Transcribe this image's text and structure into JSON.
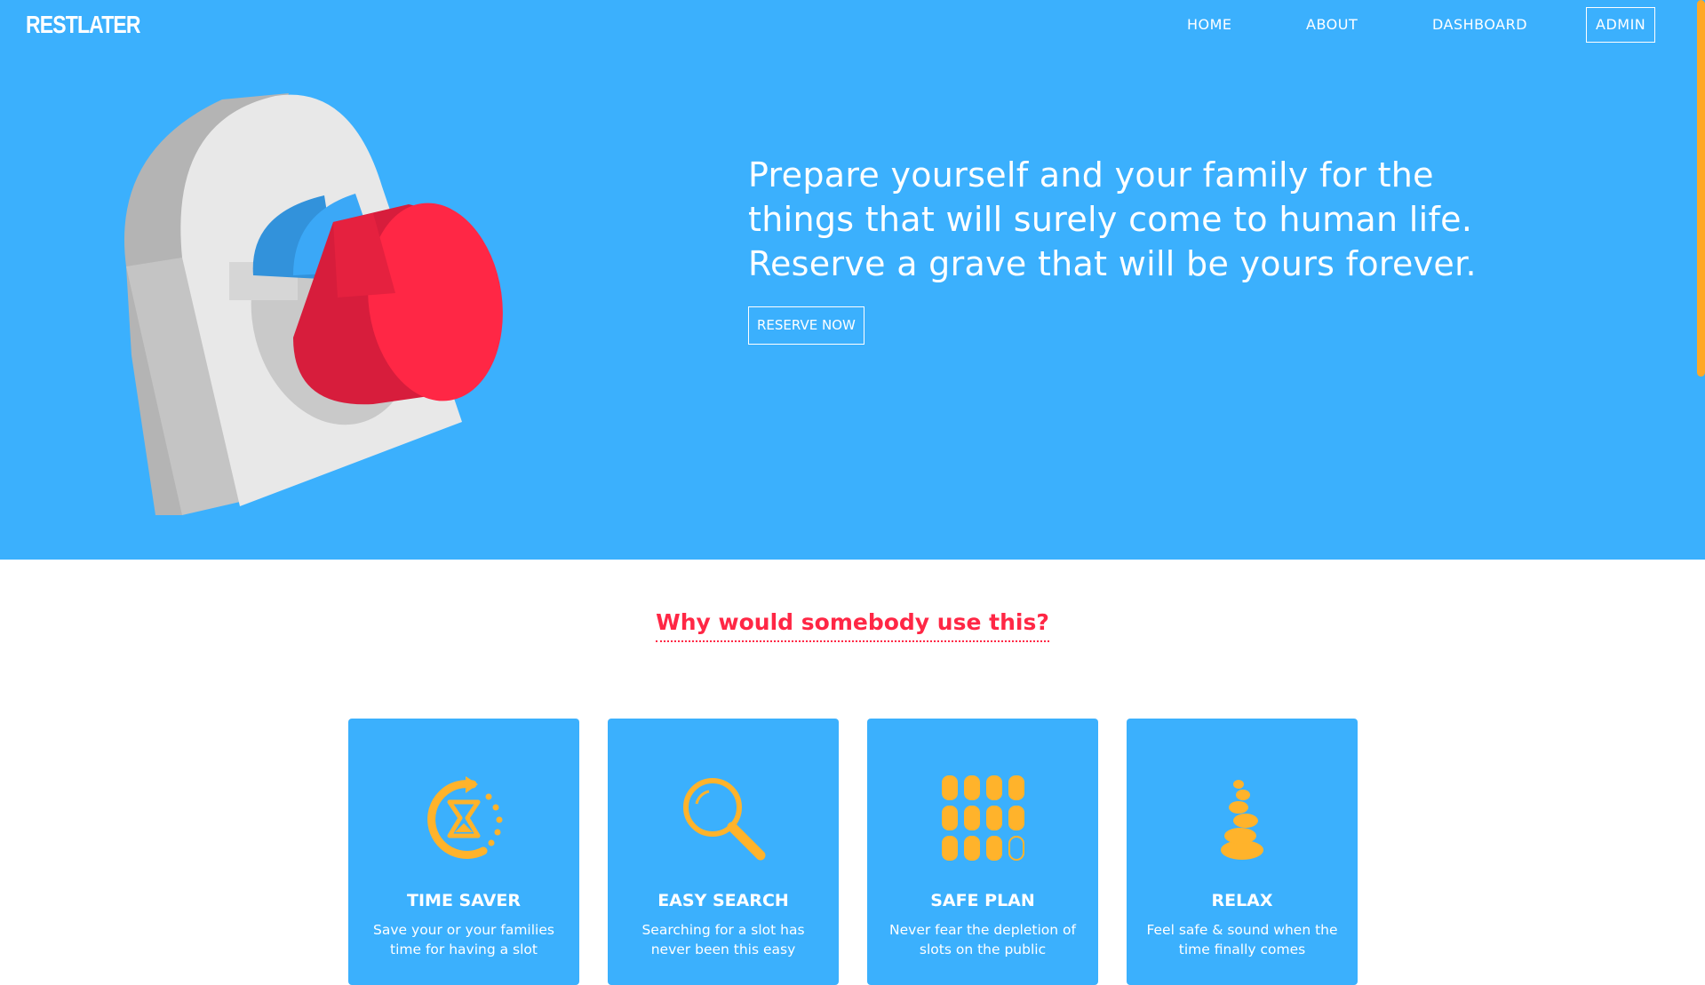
{
  "brand": {
    "name": "RESTLATER"
  },
  "nav": {
    "items": [
      {
        "label": "HOME"
      },
      {
        "label": "ABOUT"
      },
      {
        "label": "DASHBOARD"
      },
      {
        "label": "ADMIN"
      }
    ]
  },
  "hero": {
    "text": "Prepare yourself and your family for the things that will surely come to human life. Reserve a grave that will be yours forever.",
    "cta_label": "RESERVE NOW"
  },
  "features": {
    "title": "Why would somebody use this?",
    "cards": [
      {
        "icon": "hourglass-clock-icon",
        "title": "TIME SAVER",
        "desc": "Save your or your families time for having a slot"
      },
      {
        "icon": "magnifier-icon",
        "title": "EASY SEARCH",
        "desc": "Searching for a slot has never been this easy"
      },
      {
        "icon": "slots-grid-icon",
        "title": "SAFE PLAN",
        "desc": "Never fear the depletion of slots on the public"
      },
      {
        "icon": "stacked-stones-icon",
        "title": "RELAX",
        "desc": "Feel safe & sound when the time finally comes"
      }
    ]
  },
  "colors": {
    "primary": "#3bb0fd",
    "accent": "#ff2745",
    "icon": "#ffb32b",
    "scrollbar": "#ffa825",
    "text_light": "#ffffff"
  }
}
